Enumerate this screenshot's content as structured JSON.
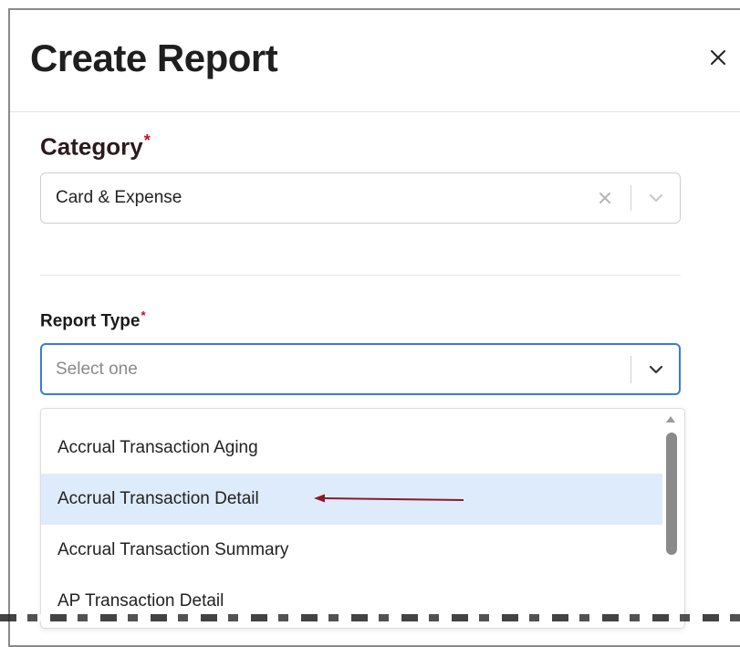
{
  "modal": {
    "title": "Create Report",
    "close_label": "X"
  },
  "category": {
    "label": "Category",
    "required_mark": "*",
    "value": "Card & Expense"
  },
  "report_type": {
    "label": "Report Type",
    "required_mark": "*",
    "placeholder": "Select one"
  },
  "dropdown": {
    "options": [
      {
        "label": "Accrual Transaction Aging"
      },
      {
        "label": "Accrual Transaction Detail"
      },
      {
        "label": "Accrual Transaction Summary"
      },
      {
        "label": "AP Transaction Detail"
      }
    ],
    "highlighted_option": "Accrual Transaction Detail"
  },
  "colors": {
    "required": "#c0122c",
    "focus_border": "#3a7bd5",
    "highlight_bg": "#deebfb",
    "annotation_arrow": "#8b1a2b"
  },
  "icons": {
    "close": "close-icon",
    "clear": "clear-x-icon",
    "chevron": "chevron-down-icon",
    "scroll_up": "scroll-up-arrow-icon",
    "annotation": "annotation-arrow-icon"
  }
}
